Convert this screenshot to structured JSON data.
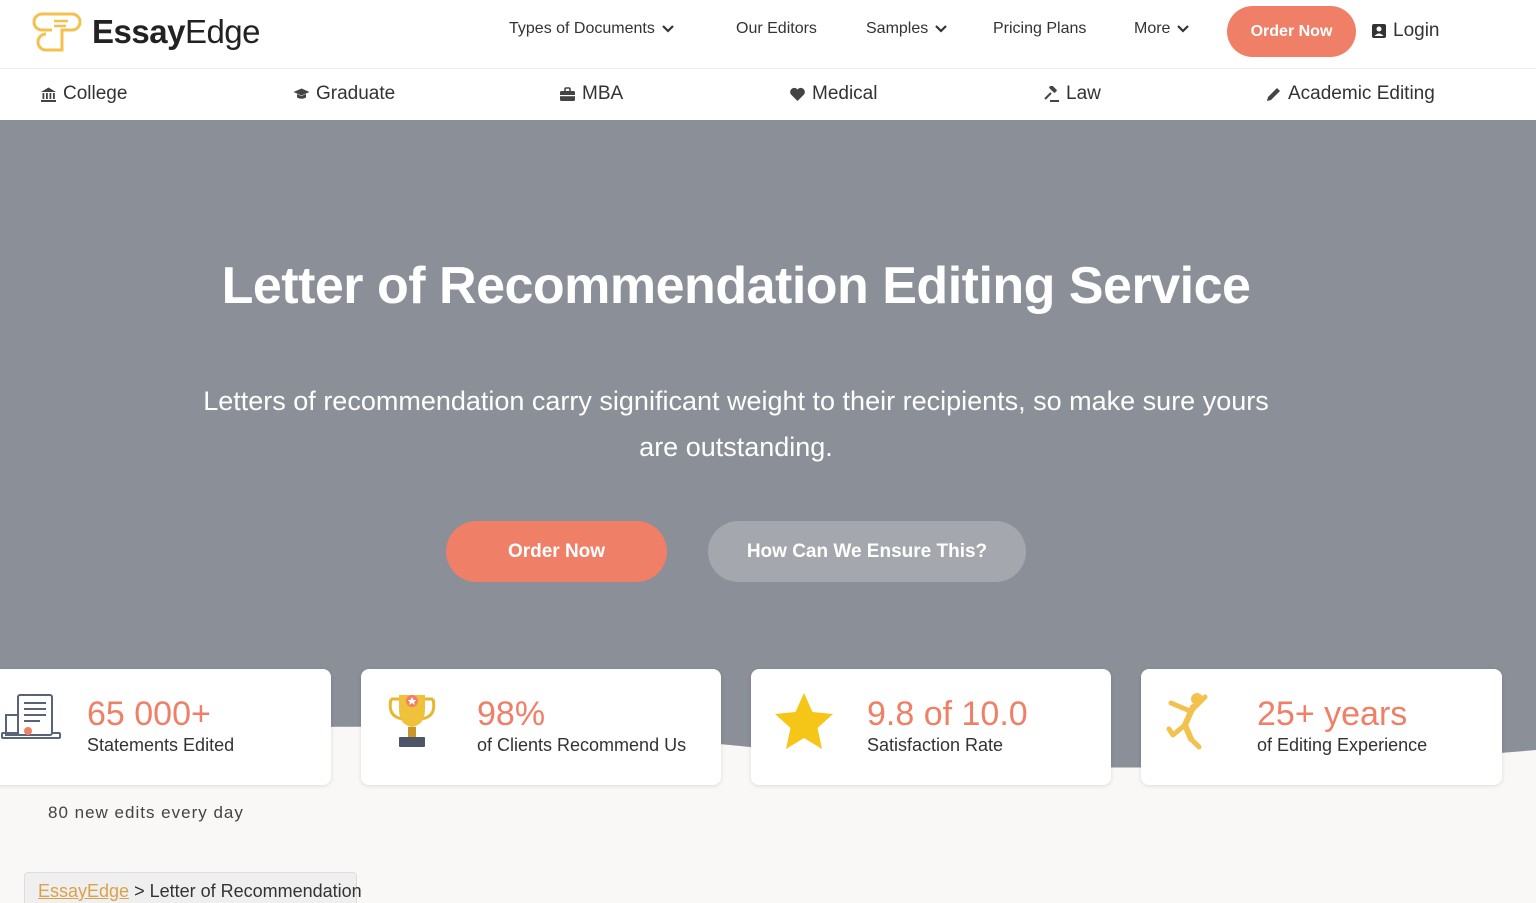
{
  "brand": {
    "name_bold": "Essay",
    "name_light": "Edge"
  },
  "nav": {
    "items": [
      {
        "label": "Types of Documents",
        "dropdown": true
      },
      {
        "label": "Our Editors",
        "dropdown": false
      },
      {
        "label": "Samples",
        "dropdown": true
      },
      {
        "label": "Pricing Plans",
        "dropdown": false
      },
      {
        "label": "More",
        "dropdown": true
      }
    ],
    "order_label": "Order Now",
    "login_label": "Login"
  },
  "subnav": {
    "items": [
      {
        "label": "College",
        "icon": "institution-icon"
      },
      {
        "label": "Graduate",
        "icon": "graduation-cap-icon"
      },
      {
        "label": "MBA",
        "icon": "briefcase-icon"
      },
      {
        "label": "Medical",
        "icon": "heart-icon"
      },
      {
        "label": "Law",
        "icon": "gavel-icon"
      },
      {
        "label": "Academic Editing",
        "icon": "pencil-icon"
      }
    ]
  },
  "hero": {
    "title": "Letter of Recommendation Editing Service",
    "subtitle": "Letters of recommendation carry significant weight to their recipients, so make sure yours are outstanding.",
    "primary_label": "Order Now",
    "secondary_label": "How Can We Ensure This?"
  },
  "stats": [
    {
      "value": "65 000+",
      "label": "Statements Edited",
      "icon": "document-icon"
    },
    {
      "value": "98%",
      "label": "of Clients Recommend Us",
      "icon": "trophy-icon"
    },
    {
      "value": "9.8 of 10.0",
      "label": "Satisfaction Rate",
      "icon": "star-icon"
    },
    {
      "value": "25+ years",
      "label": "of Editing Experience",
      "icon": "jumping-person-icon"
    }
  ],
  "edits_note": "80 new edits every day",
  "breadcrumb": {
    "home": "EssayEdge",
    "separator": " > ",
    "current": "Letter of Recommendation"
  },
  "colors": {
    "accent": "#f07f68",
    "hero_bg": "#8b8f98",
    "star": "#f5c518",
    "logo": "#f2c14e"
  }
}
